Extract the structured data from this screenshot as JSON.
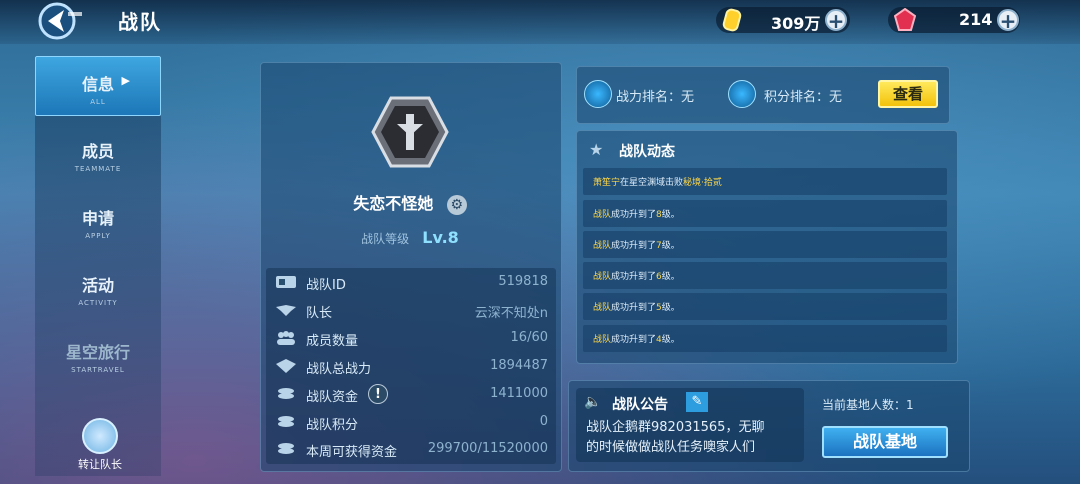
{
  "header": {
    "title": "战队",
    "coins": "309万",
    "gems": "214",
    "back_icon": "back-arrow-icon"
  },
  "sidebar": {
    "items": [
      {
        "label": "信息",
        "sub": "ALL"
      },
      {
        "label": "成员",
        "sub": "TEAMMATE"
      },
      {
        "label": "申请",
        "sub": "APPLY"
      },
      {
        "label": "活动",
        "sub": "ACTIVITY"
      },
      {
        "label": "星空旅行",
        "sub": "STARTRAVEL"
      }
    ],
    "transfer_label": "转让队长"
  },
  "team": {
    "name": "失恋不怪她",
    "level_label": "战队等级",
    "level": "Lv.8",
    "stats": [
      {
        "label": "战队ID",
        "value": "519818",
        "icon": "id-card-icon"
      },
      {
        "label": "队长",
        "value": "云深不知处n",
        "icon": "wings-icon"
      },
      {
        "label": "成员数量",
        "value": "16/60",
        "icon": "members-icon"
      },
      {
        "label": "战队总战力",
        "value": "1894487",
        "icon": "power-icon"
      },
      {
        "label": "战队资金",
        "value": "1411000",
        "icon": "coins-icon"
      },
      {
        "label": "战队积分",
        "value": "0",
        "icon": "coins-icon"
      },
      {
        "label": "本周可获得资金",
        "value": "299700/11520000",
        "icon": "coins-icon"
      }
    ]
  },
  "ranks": {
    "power_rank": "战力排名：无",
    "score_rank": "积分排名：无",
    "view_label": "查看"
  },
  "events": {
    "title": "战队动态",
    "items": [
      {
        "prefix": "萧笙宁",
        "middle": "在星空渊域击败",
        "suffix": "秘境·拾贰"
      },
      {
        "prefix": "战队",
        "middle": "成功升到了",
        "suffix": "8",
        "tail": "级。"
      },
      {
        "prefix": "战队",
        "middle": "成功升到了",
        "suffix": "7",
        "tail": "级。"
      },
      {
        "prefix": "战队",
        "middle": "成功升到了",
        "suffix": "6",
        "tail": "级。"
      },
      {
        "prefix": "战队",
        "middle": "成功升到了",
        "suffix": "5",
        "tail": "级。"
      },
      {
        "prefix": "战队",
        "middle": "成功升到了",
        "suffix": "4",
        "tail": "级。"
      }
    ]
  },
  "notice": {
    "title": "战队公告",
    "line1": "战队企鹅群982031565，无聊",
    "line2": "的时候做做战队任务噢家人们"
  },
  "base": {
    "count_label": "当前基地人数：1",
    "button_label": "战队基地"
  }
}
